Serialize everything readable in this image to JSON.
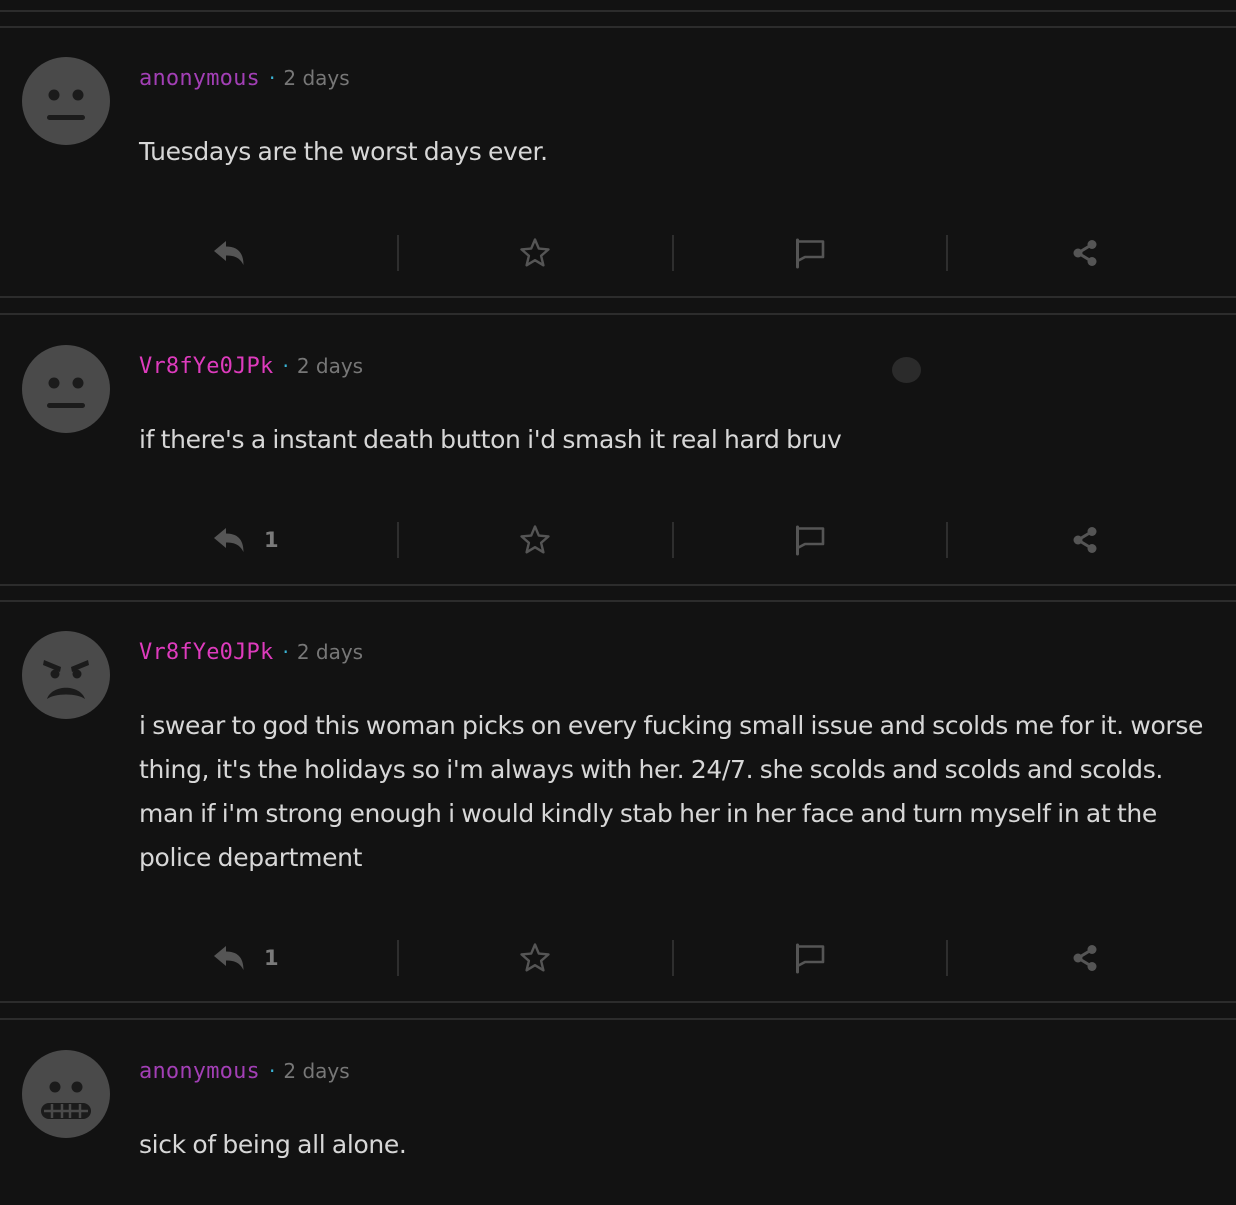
{
  "theme": {
    "username_colors": {
      "anonymous": "#a23fb5",
      "named": "#de3bbd"
    },
    "accent_dot": "#39b6d8"
  },
  "posts": [
    {
      "username": "anonymous",
      "separator": "·",
      "time": "2 days",
      "avatar": "neutral-face-icon",
      "text": "Tuesdays are the worst days ever.",
      "reply_count": ""
    },
    {
      "username": "Vr8fYe0JPk",
      "separator": "·",
      "time": "2 days",
      "avatar": "neutral-face-icon",
      "text": "if there's a instant death button i'd smash it real hard bruv",
      "reply_count": "1"
    },
    {
      "username": "Vr8fYe0JPk",
      "separator": "·",
      "time": "2 days",
      "avatar": "angry-face-icon",
      "text": "i swear to god this woman picks on every fucking small issue and scolds me for it. worse thing, it's the holidays so i'm always with her. 24/7. she scolds and scolds and scolds. man if i'm strong enough i would kindly stab her in her face and turn myself in at the police department",
      "reply_count": "1"
    },
    {
      "username": "anonymous",
      "separator": "·",
      "time": "2 days",
      "avatar": "grimacing-face-icon",
      "text": "sick of being all alone.",
      "reply_count": ""
    }
  ],
  "action_icons": [
    "reply-icon",
    "star-icon",
    "flag-icon",
    "share-icon"
  ]
}
